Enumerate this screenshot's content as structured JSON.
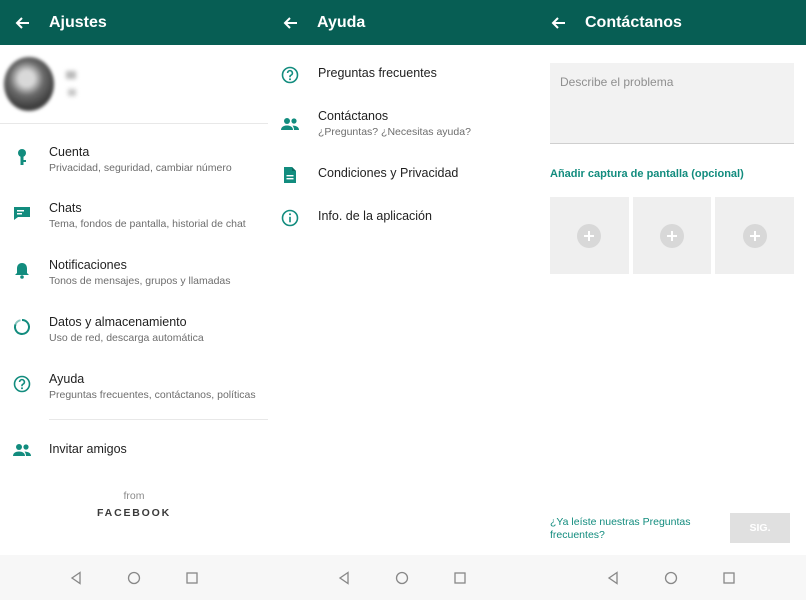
{
  "colors": {
    "appbar": "#075e54",
    "accent": "#128c7e",
    "icon": "#128c7e"
  },
  "settings": {
    "title": "Ajustes",
    "items": [
      {
        "icon": "key-icon",
        "label": "Cuenta",
        "sublabel": "Privacidad, seguridad, cambiar número"
      },
      {
        "icon": "chat-icon",
        "label": "Chats",
        "sublabel": "Tema, fondos de pantalla, historial de chat"
      },
      {
        "icon": "bell-icon",
        "label": "Notificaciones",
        "sublabel": "Tonos de mensajes, grupos y llamadas"
      },
      {
        "icon": "data-usage-icon",
        "label": "Datos y almacenamiento",
        "sublabel": "Uso de red, descarga automática"
      },
      {
        "icon": "help-icon",
        "label": "Ayuda",
        "sublabel": "Preguntas frecuentes, contáctanos, políticas"
      }
    ],
    "invite": {
      "icon": "people-icon",
      "label": "Invitar amigos"
    },
    "footer_from": "from",
    "footer_brand": "FACEBOOK"
  },
  "help": {
    "title": "Ayuda",
    "items": [
      {
        "icon": "help-icon",
        "label": "Preguntas frecuentes",
        "sublabel": ""
      },
      {
        "icon": "people-icon",
        "label": "Contáctanos",
        "sublabel": "¿Preguntas? ¿Necesitas ayuda?"
      },
      {
        "icon": "document-icon",
        "label": "Condiciones y Privacidad",
        "sublabel": ""
      },
      {
        "icon": "info-icon",
        "label": "Info. de la aplicación",
        "sublabel": ""
      }
    ]
  },
  "contact": {
    "title": "Contáctanos",
    "description_placeholder": "Describe el problema",
    "screenshot_label": "Añadir captura de pantalla (opcional)",
    "faq_link": "¿Ya leíste nuestras Preguntas frecuentes?",
    "next_button": "SIG."
  }
}
